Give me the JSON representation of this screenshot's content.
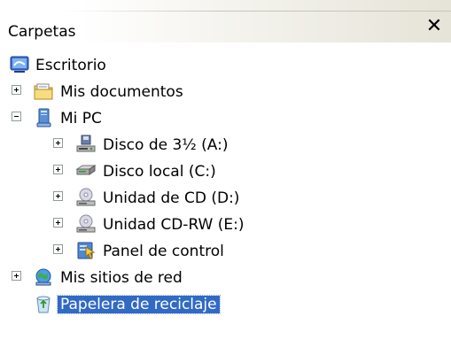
{
  "panel": {
    "title": "Carpetas",
    "close_label": "✕"
  },
  "tree": {
    "items": [
      {
        "label": "Escritorio",
        "icon": "desktop-icon",
        "expander": "none"
      },
      {
        "label": "Mis documentos",
        "icon": "folder-documents-icon",
        "expander": "plus"
      },
      {
        "label": "Mi PC",
        "icon": "computer-icon",
        "expander": "minus"
      },
      {
        "label": "Disco de 3½ (A:)",
        "icon": "floppy-drive-icon",
        "expander": "plus"
      },
      {
        "label": "Disco local (C:)",
        "icon": "hard-disk-icon",
        "expander": "plus"
      },
      {
        "label": "Unidad de CD (D:)",
        "icon": "cd-drive-icon",
        "expander": "plus"
      },
      {
        "label": "Unidad CD-RW (E:)",
        "icon": "cd-drive-icon",
        "expander": "plus"
      },
      {
        "label": "Panel de control",
        "icon": "control-panel-icon",
        "expander": "plus"
      },
      {
        "label": "Mis sitios de red",
        "icon": "network-places-icon",
        "expander": "plus"
      },
      {
        "label": "Papelera de reciclaje",
        "icon": "recycle-bin-icon",
        "expander": "none",
        "selected": true
      }
    ]
  },
  "colors": {
    "selection": "#316ac5",
    "header_gradient_end": "#e6e3d8"
  }
}
